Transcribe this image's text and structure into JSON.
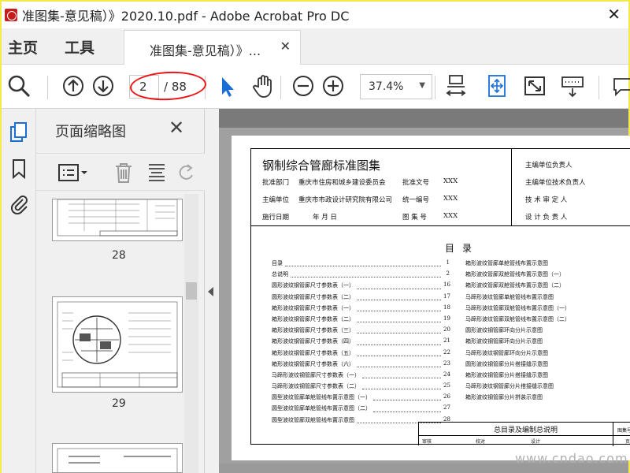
{
  "window": {
    "title": "准图集-意见稿）》2020.10.pdf - Adobe Acrobat Pro DC"
  },
  "tabs": {
    "home": "主页",
    "tools": "工具",
    "document": "准图集-意见稿）》..."
  },
  "toolbar": {
    "current_page": "2",
    "page_total": "/ 88",
    "zoom": "37.4%"
  },
  "panel": {
    "title": "页面缩略图",
    "thumbs": [
      "28",
      "29"
    ]
  },
  "document": {
    "title": "钢制综合管廊标准图集",
    "rows": [
      {
        "label": "批准部门",
        "value": "重庆市住房和城乡建设委员会",
        "k2": "批准文号",
        "v2": "XXX"
      },
      {
        "label": "主编单位",
        "value": "重庆市市政设计研究院有限公司",
        "k2": "统一编号",
        "v2": "XXX"
      },
      {
        "label": "施行日期",
        "value": "年    月    日",
        "k2": "图 集 号",
        "v2": "XXX"
      }
    ],
    "right_roles": [
      "主编单位负责人",
      "主编单位技术负责人",
      "技 术 审 定 人",
      "设 计 负 责 人"
    ],
    "toc_title": "目录",
    "toc_left": [
      {
        "t": "目录",
        "n": "1"
      },
      {
        "t": "总说明",
        "n": "2"
      },
      {
        "t": "圆形波纹钢管廊尺寸参数表（一）",
        "n": "16"
      },
      {
        "t": "圆形波纹钢管廊尺寸参数表（二）",
        "n": "17"
      },
      {
        "t": "箱形波纹钢管廊尺寸参数表（一）",
        "n": "18"
      },
      {
        "t": "箱形波纹钢管廊尺寸参数表（二）",
        "n": "19"
      },
      {
        "t": "箱形波纹钢管廊尺寸参数表（三）",
        "n": "20"
      },
      {
        "t": "箱形波纹钢管廊尺寸参数表（四）",
        "n": "21"
      },
      {
        "t": "箱形波纹钢管廊尺寸参数表（五）",
        "n": "22"
      },
      {
        "t": "箱形波纹钢管廊尺寸参数表（六）",
        "n": "23"
      },
      {
        "t": "马蹄形波纹钢管廊尺寸参数表（一）",
        "n": "24"
      },
      {
        "t": "马蹄形波纹钢管廊尺寸参数表（二）",
        "n": "25"
      },
      {
        "t": "圆型波纹管廊单舱管线布置示意图（一）",
        "n": "26"
      },
      {
        "t": "圆型波纹管廊单舱管线布置示意图（二）",
        "n": "27"
      },
      {
        "t": "圆型波纹管廊双舱管线布置示意图",
        "n": "28"
      }
    ],
    "toc_right": [
      "箱形波纹管廊单舱管线布置示意图",
      "箱形波纹管廊双舱管线布置示意图（一）",
      "箱形波纹管廊双舱管线布置示意图（二）",
      "马蹄形波纹管廊单舱管线布置示意图",
      "马蹄形波纹管廊双舱管线布置示意图（一）",
      "马蹄形波纹管廊双舱管线布置示意图（二）",
      "圆形波纹钢管廊环向分片示意图",
      "箱形波纹钢管廊环向分片示意图",
      "马蹄形波纹钢管廊环向分片示意图",
      "圆形波纹钢管廊分片搭接缝示意图",
      "箱形波纹钢管廊分片搭接缝示意图",
      "马蹄形波纹钢管廊分片搭接缝示意图",
      "箱形波纹钢管廊分片拼装示意图"
    ],
    "titleblock_name": "总目录及编制总说明",
    "titleblock_cells": [
      "审核",
      "校对",
      "设计",
      "图集号",
      "页"
    ]
  },
  "watermark": "www.cndao.com"
}
